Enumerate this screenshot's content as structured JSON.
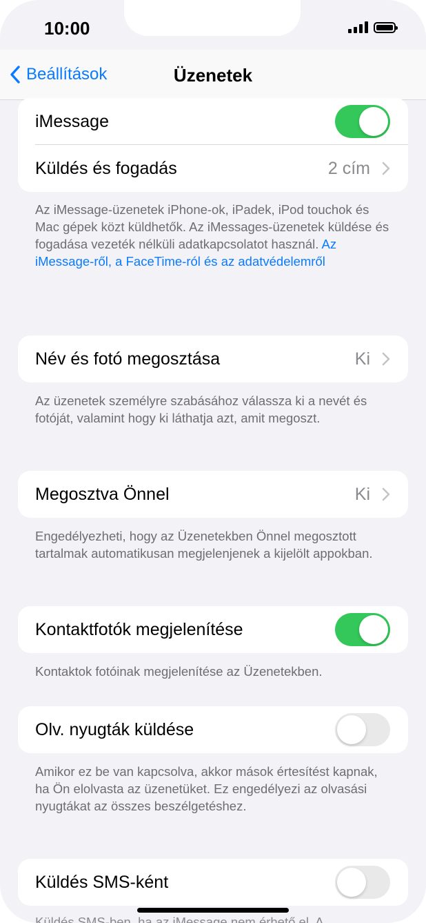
{
  "status": {
    "time": "10:00"
  },
  "nav": {
    "back_label": "Beállítások",
    "title": "Üzenetek"
  },
  "sections": {
    "imessage": {
      "imessage_label": "iMessage",
      "imessage_on": true,
      "send_receive_label": "Küldés és fogadás",
      "send_receive_value": "2 cím",
      "footer": "Az iMessage-üzenetek iPhone-ok, iPadek, iPod touchok és Mac gépek közt küldhetők. Az iMessages-üzenetek küldése és fogadása vezeték nélküli adatkapcsolatot használ.",
      "footer_link": "Az iMessage-ről, a FaceTime-ról és az adatvédelemről"
    },
    "name_photo": {
      "label": "Név és fotó megosztása",
      "value": "Ki",
      "footer": "Az üzenetek személyre szabásához válassza ki a nevét és fotóját, valamint hogy ki láthatja azt, amit megoszt."
    },
    "shared": {
      "label": "Megosztva Önnel",
      "value": "Ki",
      "footer": "Engedélyezheti, hogy az Üzenetekben Önnel megosztott tartalmak automatikusan megjelenjenek a kijelölt appokban."
    },
    "contact_photos": {
      "label": "Kontaktfotók megjelenítése",
      "on": true,
      "footer": "Kontaktok fotóinak megjelenítése az Üzenetekben."
    },
    "read_receipts": {
      "label": "Olv. nyugták küldése",
      "on": false,
      "footer": "Amikor ez be van kapcsolva, akkor mások értesítést kapnak, ha Ön elolvasta az üzenetüket. Ez engedélyezi az olvasási nyugtákat az összes beszélgetéshez."
    },
    "sms": {
      "label": "Küldés SMS-ként",
      "on": false,
      "footer_cut": "Küldés SMS-ben, ha az iMessage nem érhető el. A"
    }
  },
  "colors": {
    "accent": "#0a7aff",
    "toggle_on": "#34c759",
    "toggle_off": "#e9e9ea",
    "background": "#f2f2f7"
  }
}
